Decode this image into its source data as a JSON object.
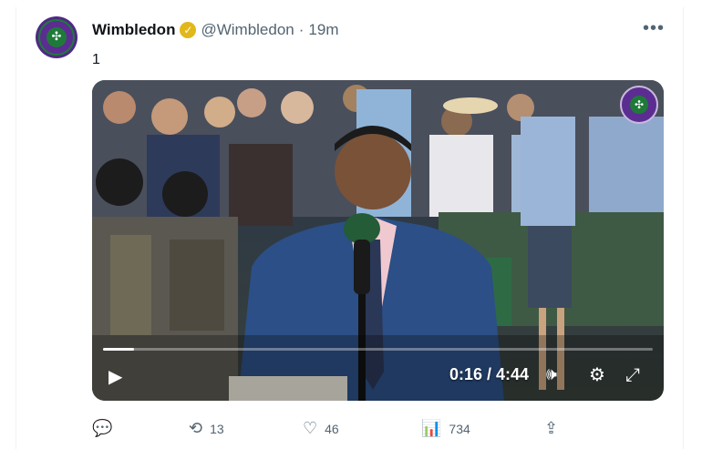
{
  "tweet": {
    "display_name": "Wimbledon",
    "handle": "@Wimbledon",
    "separator": "·",
    "time_ago": "19m",
    "text": "1",
    "more_glyph": "•••",
    "avatar_icon": "wimbledon-logo",
    "verified_color": "#e2b719"
  },
  "video": {
    "current_time": "0:16",
    "duration": "4:44",
    "timecode": "0:16 / 4:44",
    "progress_fraction": 0.056,
    "icons": {
      "play": "play-icon",
      "volume": "volume-icon",
      "settings": "gear-icon",
      "fullscreen": "expand-icon"
    }
  },
  "actions": {
    "reply_count": "",
    "retweet_count": "13",
    "like_count": "46",
    "views_count": "734"
  }
}
